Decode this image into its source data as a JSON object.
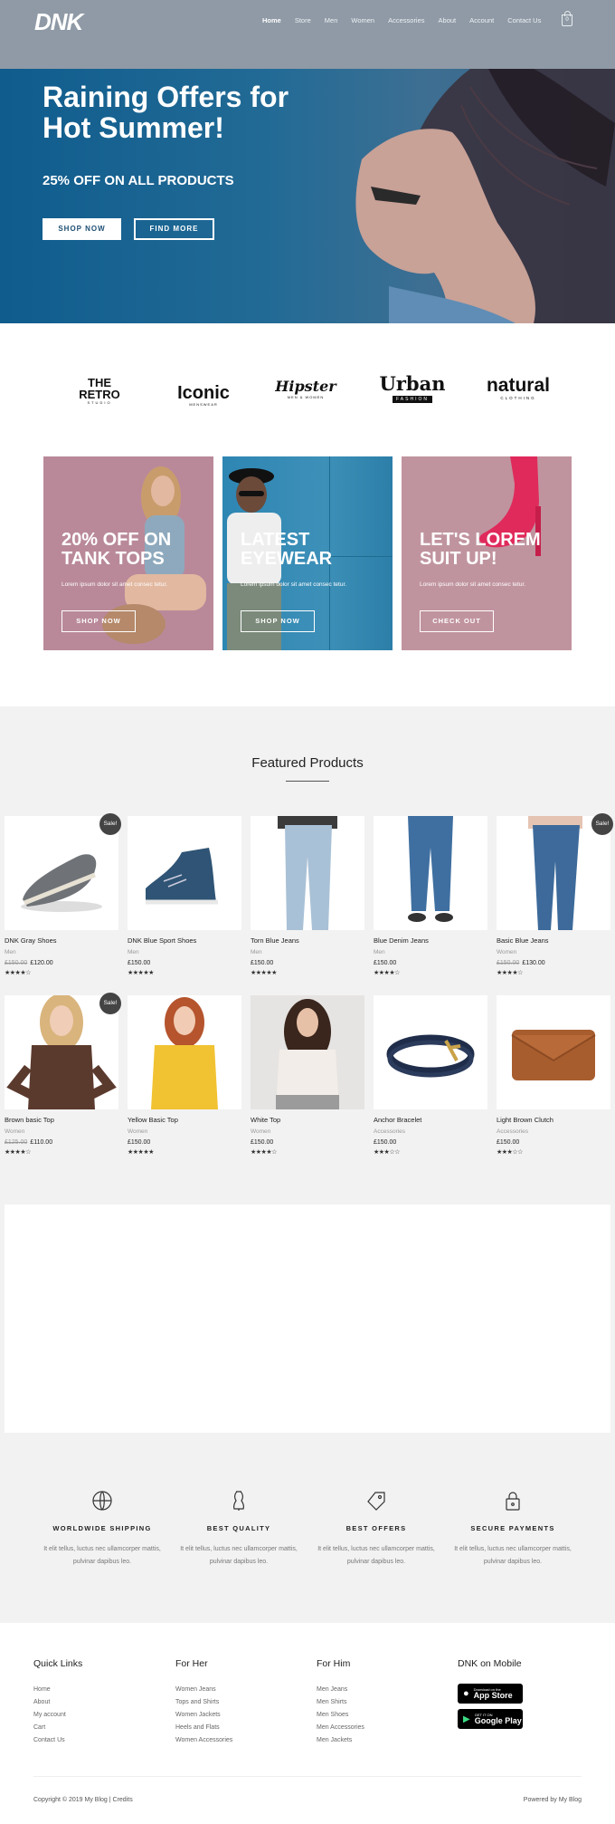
{
  "header": {
    "logo": "DNK",
    "nav": [
      "Home",
      "Store",
      "Men",
      "Women",
      "Accessories",
      "About",
      "Account",
      "Contact Us"
    ],
    "cart_count": "0"
  },
  "hero": {
    "title": "Raining Offers for Hot Summer!",
    "subtitle": "25% OFF ON ALL PRODUCTS",
    "shop_now": "SHOP NOW",
    "find_more": "FIND MORE"
  },
  "brands": [
    {
      "name": "THE RETRO",
      "sub": "STUDIO"
    },
    {
      "name": "Iconic",
      "sub": "MENSWEAR"
    },
    {
      "name": "Hipster",
      "sub": "MEN & WOMEN"
    },
    {
      "name": "Urban",
      "sub": "FASHION"
    },
    {
      "name": "natural",
      "sub": "CLOTHING"
    }
  ],
  "promos": [
    {
      "title": "20% OFF ON TANK TOPS",
      "text": "Lorem ipsum dolor sit amet consec tetur.",
      "button": "SHOP NOW",
      "bg": "#b9899a"
    },
    {
      "title": "LATEST EYEWEAR",
      "text": "Lorem ipsum dolor sit amet consec tetur.",
      "button": "SHOP NOW",
      "bg": "#3a8bb0"
    },
    {
      "title": "LET'S LOREM SUIT UP!",
      "text": "Lorem ipsum dolor sit amet consec tetur.",
      "button": "CHECK OUT",
      "bg": "#c0949f"
    }
  ],
  "featured": {
    "title": "Featured Products",
    "sale_label": "Sale!",
    "products": [
      {
        "name": "DNK Gray Shoes",
        "cat": "Men",
        "old": "£150.00",
        "price": "£120.00",
        "stars": "★★★★☆",
        "sale": true
      },
      {
        "name": "DNK Blue Sport Shoes",
        "cat": "Men",
        "old": "",
        "price": "£150.00",
        "stars": "★★★★★",
        "sale": false
      },
      {
        "name": "Torn Blue Jeans",
        "cat": "Men",
        "old": "",
        "price": "£150.00",
        "stars": "★★★★★",
        "sale": false
      },
      {
        "name": "Blue Denim Jeans",
        "cat": "Men",
        "old": "",
        "price": "£150.00",
        "stars": "★★★★☆",
        "sale": false
      },
      {
        "name": "Basic Blue Jeans",
        "cat": "Women",
        "old": "£150.00",
        "price": "£130.00",
        "stars": "★★★★☆",
        "sale": true
      },
      {
        "name": "Brown basic Top",
        "cat": "Women",
        "old": "£125.00",
        "price": "£110.00",
        "stars": "★★★★☆",
        "sale": true
      },
      {
        "name": "Yellow Basic Top",
        "cat": "Women",
        "old": "",
        "price": "£150.00",
        "stars": "★★★★★",
        "sale": false
      },
      {
        "name": "White Top",
        "cat": "Women",
        "old": "",
        "price": "£150.00",
        "stars": "★★★★☆",
        "sale": false
      },
      {
        "name": "Anchor Bracelet",
        "cat": "Accessories",
        "old": "",
        "price": "£150.00",
        "stars": "★★★☆☆",
        "sale": false
      },
      {
        "name": "Light Brown Clutch",
        "cat": "Accessories",
        "old": "",
        "price": "£150.00",
        "stars": "★★★☆☆",
        "sale": false
      }
    ]
  },
  "features": [
    {
      "icon": "globe-icon",
      "title": "WORLDWIDE SHIPPING",
      "text": "It elit tellus, luctus nec ullamcorper mattis, pulvinar dapibus leo."
    },
    {
      "icon": "dress-form-icon",
      "title": "BEST QUALITY",
      "text": "It elit tellus, luctus nec ullamcorper mattis, pulvinar dapibus leo."
    },
    {
      "icon": "price-tag-icon",
      "title": "BEST OFFERS",
      "text": "It elit tellus, luctus nec ullamcorper mattis, pulvinar dapibus leo."
    },
    {
      "icon": "lock-icon",
      "title": "SECURE PAYMENTS",
      "text": "It elit tellus, luctus nec ullamcorper mattis, pulvinar dapibus leo."
    }
  ],
  "footer": {
    "quick_links": {
      "title": "Quick Links",
      "links": [
        "Home",
        "About",
        "My account",
        "Cart",
        "Contact Us"
      ]
    },
    "for_her": {
      "title": "For Her",
      "links": [
        "Women Jeans",
        "Tops and Shirts",
        "Women Jackets",
        "Heels and Flats",
        "Women Accessories"
      ]
    },
    "for_him": {
      "title": "For Him",
      "links": [
        "Men Jeans",
        "Men Shirts",
        "Men Shoes",
        "Men Accessories",
        "Men Jackets"
      ]
    },
    "mobile": {
      "title": "DNK on Mobile",
      "app_store_small": "Download on the",
      "app_store": "App Store",
      "google_small": "GET IT ON",
      "google": "Google Play"
    },
    "copyright": "Copyright © 2019 My Blog | Credits",
    "powered": "Powered by My Blog"
  }
}
